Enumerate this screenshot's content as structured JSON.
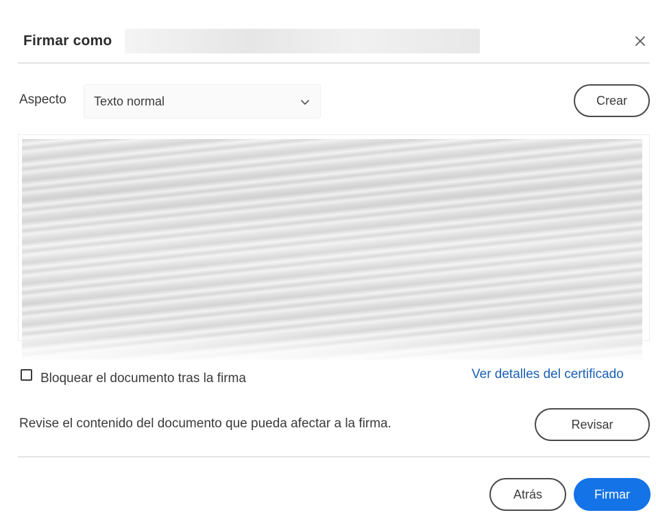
{
  "dialog": {
    "title": "Firmar como",
    "close_icon": "close-icon"
  },
  "appearance": {
    "label": "Aspecto",
    "selected": "Texto normal",
    "chevron_icon": "chevron-down-icon",
    "create_label": "Crear"
  },
  "lock": {
    "checked": false,
    "label": "Bloquear el documento tras la firma"
  },
  "certificate": {
    "link_label": "Ver detalles del certificado"
  },
  "review": {
    "text": "Revise el contenido del documento que pueda afectar a la firma.",
    "button_label": "Revisar"
  },
  "footer": {
    "back_label": "Atrás",
    "sign_label": "Firmar"
  },
  "colors": {
    "primary": "#1473e6",
    "link": "#1a5fb4",
    "text": "#2c2c2c"
  }
}
